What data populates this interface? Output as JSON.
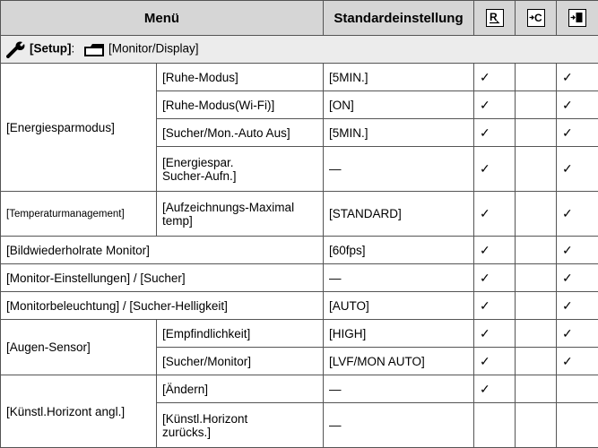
{
  "header": {
    "menu": "Menü",
    "default": "Standardeinstellung",
    "icon_1": "R-reset-icon",
    "icon_2": "C-custom-icon",
    "icon_3": "save-icon"
  },
  "section": {
    "tab": "[Setup]",
    "sep": ":",
    "page": "[Monitor/Display]"
  },
  "check": "✓",
  "dash": "—",
  "rows": {
    "energy_group": "[Energiesparmodus]",
    "sleep": "[Ruhe-Modus]",
    "sleep_val": "[5MIN.]",
    "sleep_wifi": "[Ruhe-Modus(Wi-Fi)]",
    "sleep_wifi_val": "[ON]",
    "vf_auto_off": "[Sucher/Mon.-Auto Aus]",
    "vf_auto_off_val": "[5MIN.]",
    "energy_rec_1": "[Energiespar.",
    "energy_rec_2": "Sucher-Aufn.]",
    "temp_group": "[Temperaturmanagement]",
    "temp_item_1": "[Aufzeichnungs-Maximal",
    "temp_item_2": "temp]",
    "temp_val": "[STANDARD]",
    "refresh": "[Bildwiederholrate Monitor]",
    "refresh_val": "[60fps]",
    "monitor_settings": "[Monitor-Einstellungen] / [Sucher]",
    "backlight": "[Monitorbeleuchtung] / [Sucher-Helligkeit]",
    "backlight_val": "[AUTO]",
    "eye_group": "[Augen-Sensor]",
    "sensitivity": "[Empfindlichkeit]",
    "sensitivity_val": "[HIGH]",
    "vf_monitor": "[Sucher/Monitor]",
    "vf_monitor_val": "[LVF/MON AUTO]",
    "level_group": "[Künstl.Horizont angl.]",
    "level_change": "[Ändern]",
    "level_reset_1": "[Künstl.Horizont",
    "level_reset_2": "zurücks.]"
  }
}
